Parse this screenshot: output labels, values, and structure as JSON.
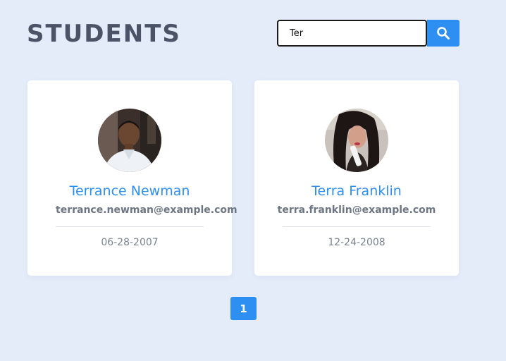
{
  "header": {
    "title": "STUDENTS"
  },
  "search": {
    "value": "Ter",
    "button_icon": "search-icon"
  },
  "students": [
    {
      "name": "Terrance Newman",
      "email": "terrance.newman@example.com",
      "dob": "06-28-2007",
      "avatar": "avatar-photo-male"
    },
    {
      "name": "Terra Franklin",
      "email": "terra.franklin@example.com",
      "dob": "12-24-2008",
      "avatar": "avatar-photo-female"
    }
  ],
  "pagination": {
    "current_page": "1"
  },
  "colors": {
    "background": "#e4ecfa",
    "accent": "#2d8ff1",
    "title": "#4a5466",
    "card": "#ffffff"
  }
}
